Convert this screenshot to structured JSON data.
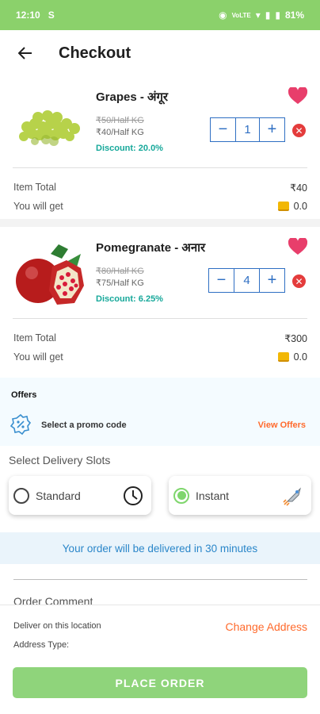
{
  "status_bar": {
    "time": "12:10",
    "sim": "S",
    "signal_text": "VoLTE",
    "battery": "81%"
  },
  "header": {
    "title": "Checkout"
  },
  "products": [
    {
      "name": "Grapes - अंगूर",
      "mrp": "₹50/Half KG",
      "price": "₹40/Half KG",
      "discount": "Discount: 20.0%",
      "quantity": "1",
      "item_total_label": "Item Total",
      "item_total": "₹40",
      "you_will_get_label": "You will get",
      "coins": "0.0",
      "image": "grapes-image"
    },
    {
      "name": "Pomegranate - अनार",
      "mrp": "₹80/Half KG",
      "price": "₹75/Half KG",
      "discount": "Discount: 6.25%",
      "quantity": "4",
      "item_total_label": "Item Total",
      "item_total": "₹300",
      "you_will_get_label": "You will get",
      "coins": "0.0",
      "image": "pomegranate-image"
    }
  ],
  "stepper": {
    "minus": "−",
    "plus": "+"
  },
  "remove_icon": "✕",
  "offers": {
    "title": "Offers",
    "promo_text": "Select a promo code",
    "view_offers": "View Offers"
  },
  "delivery": {
    "title": "Select Delivery Slots",
    "slots": [
      {
        "label": "Standard",
        "selected": false,
        "icon": "clock-icon"
      },
      {
        "label": "Instant",
        "selected": true,
        "icon": "rocket-icon"
      }
    ],
    "message": "Your order will be delivered in 30 minutes"
  },
  "order_comment": {
    "label": "Order Comment"
  },
  "address": {
    "deliver_label": "Deliver on this location",
    "address_type_label": "Address Type:",
    "change_address": "Change Address"
  },
  "place_order": {
    "label": "PLACE ORDER"
  },
  "colors": {
    "status_bar": "#8bd16b",
    "accent_blue": "#2f6fc3",
    "discount_teal": "#16a89a",
    "orange": "#ff6a2c",
    "heart_pink": "#e83e6b",
    "place_order_green": "#8fd47b"
  }
}
